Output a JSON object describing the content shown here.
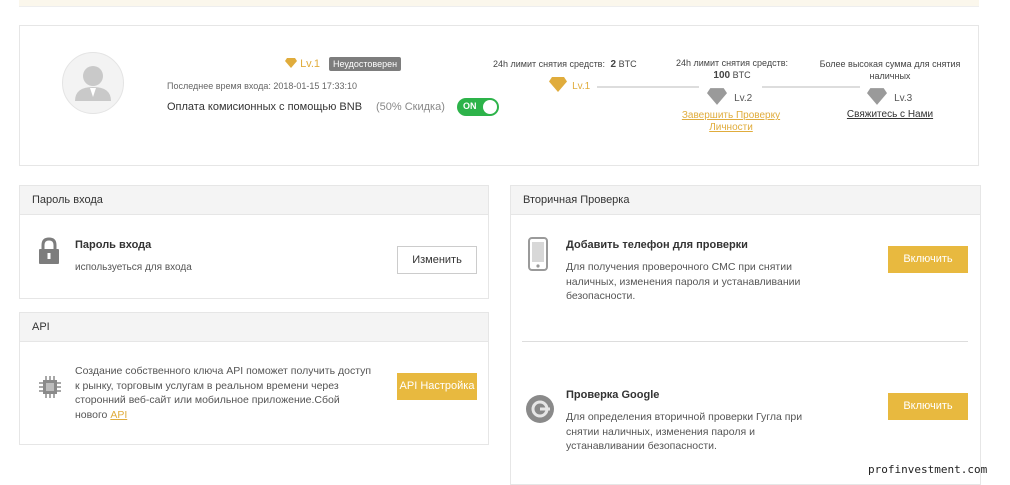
{
  "profile": {
    "level": "Lv.1",
    "verification_badge": "Неудостоверен",
    "last_login_label": "Последнее время входа:",
    "last_login_value": "2018-01-15 17:33:10",
    "bnb_fee_label": "Оплата комисионных с помощью BNB",
    "bnb_discount": "(50% Скидка)",
    "bnb_toggle_state": "ON"
  },
  "limits": {
    "level1": {
      "label": "24h лимит снятия средств:",
      "amount": "2",
      "unit": "BTC",
      "level": "Lv.1"
    },
    "level2": {
      "label": "24h лимит снятия средств:",
      "amount": "100",
      "unit": "BTC",
      "level": "Lv.2",
      "action": "Завершить Проверку Личности"
    },
    "level3": {
      "label": "Более высокая сумма для снятия наличных",
      "level": "Lv.3",
      "action": "Свяжитесь с Нами"
    }
  },
  "login_password": {
    "section_title": "Пароль входа",
    "item_title": "Пароль входа",
    "item_desc": "используеться для входа",
    "button": "Изменить"
  },
  "api": {
    "section_title": "API",
    "desc": "Создание собственного ключа API поможет получить доступ к рынку, торговым услугам в реальном времени через сторонний веб-сайт или мобильное приложение.Сбой нового",
    "desc_link": "API",
    "button": "API Настройка"
  },
  "secondary": {
    "section_title": "Вторичная Проверка",
    "phone": {
      "title": "Добавить телефон для проверки",
      "desc": "Для получения проверочного СМС при снятии наличных, изменения пароля и устанавливании безопасности.",
      "button": "Включить"
    },
    "google": {
      "title": "Проверка Google",
      "desc": "Для определения вторичной проверки Гугла при снятии наличных, изменения пароля и устанавливании безопасности.",
      "button": "Включить"
    }
  },
  "watermark": "profinvestment.com",
  "colors": {
    "accent": "#e8b93f",
    "toggle_on": "#2db34a",
    "badge": "#7d7d7d"
  }
}
